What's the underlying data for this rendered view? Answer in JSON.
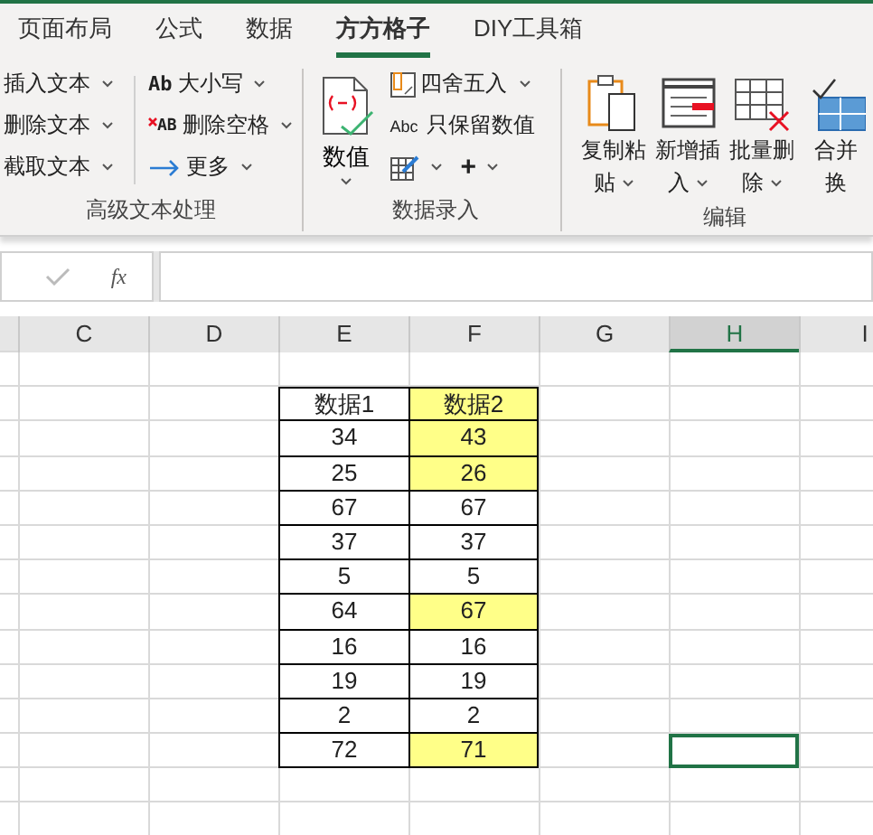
{
  "tabs": [
    {
      "label": "页面布局",
      "selected": false
    },
    {
      "label": "公式",
      "selected": false
    },
    {
      "label": "数据",
      "selected": false
    },
    {
      "label": "方方格子",
      "selected": true
    },
    {
      "label": "DIY工具箱",
      "selected": false
    }
  ],
  "ribbon": {
    "text_group": {
      "label": "高级文本处理",
      "column_1": [
        "插入文本",
        "删除文本",
        "截取文本"
      ],
      "column_2": [
        {
          "icon": "Ab",
          "label": "大小写"
        },
        {
          "icon": "AB",
          "label": "删除空格"
        },
        {
          "label": "更多"
        }
      ]
    },
    "entry_group": {
      "label": "数据录入",
      "big_button": "数值",
      "round_button": "四舍五入",
      "keep_icon": "Abc",
      "keep_button": "只保留数值",
      "plus": "+"
    },
    "edit_group": {
      "label": "编辑",
      "buttons": [
        {
          "kind": "paste",
          "lines": [
            "复制粘",
            "贴"
          ]
        },
        {
          "kind": "insert",
          "lines": [
            "新增插",
            "入"
          ]
        },
        {
          "kind": "delete",
          "lines": [
            "批量删",
            "除"
          ]
        },
        {
          "kind": "merge",
          "lines": [
            "合并",
            "换"
          ]
        }
      ]
    }
  },
  "formula_bar": {
    "fx": "fx"
  },
  "sheet": {
    "columns": [
      {
        "label": "C",
        "selected": false
      },
      {
        "label": "D",
        "selected": false
      },
      {
        "label": "E",
        "selected": false
      },
      {
        "label": "F",
        "selected": false
      },
      {
        "label": "G",
        "selected": false
      },
      {
        "label": "H",
        "selected": true
      },
      {
        "label": "I",
        "selected": false
      }
    ],
    "table": {
      "header": [
        {
          "text": "数据1",
          "highlighted": false
        },
        {
          "text": "数据2",
          "highlighted": true
        }
      ],
      "rows": [
        {
          "cells": [
            {
              "text": "34",
              "highlighted": false
            },
            {
              "text": "43",
              "highlighted": true
            }
          ],
          "h_selected": false
        },
        {
          "cells": [
            {
              "text": "25",
              "highlighted": false
            },
            {
              "text": "26",
              "highlighted": true
            }
          ],
          "h_selected": false
        },
        {
          "cells": [
            {
              "text": "67",
              "highlighted": false
            },
            {
              "text": "67",
              "highlighted": false
            }
          ],
          "h_selected": false
        },
        {
          "cells": [
            {
              "text": "37",
              "highlighted": false
            },
            {
              "text": "37",
              "highlighted": false
            }
          ],
          "h_selected": false
        },
        {
          "cells": [
            {
              "text": "5",
              "highlighted": false
            },
            {
              "text": "5",
              "highlighted": false
            }
          ],
          "h_selected": false
        },
        {
          "cells": [
            {
              "text": "64",
              "highlighted": false
            },
            {
              "text": "67",
              "highlighted": true
            }
          ],
          "h_selected": false
        },
        {
          "cells": [
            {
              "text": "16",
              "highlighted": false
            },
            {
              "text": "16",
              "highlighted": false
            }
          ],
          "h_selected": false
        },
        {
          "cells": [
            {
              "text": "19",
              "highlighted": false
            },
            {
              "text": "19",
              "highlighted": false
            }
          ],
          "h_selected": false
        },
        {
          "cells": [
            {
              "text": "2",
              "highlighted": false
            },
            {
              "text": "2",
              "highlighted": false
            }
          ],
          "h_selected": false
        },
        {
          "cells": [
            {
              "text": "72",
              "highlighted": false
            },
            {
              "text": "71",
              "highlighted": true
            }
          ],
          "h_selected": true
        }
      ]
    }
  }
}
